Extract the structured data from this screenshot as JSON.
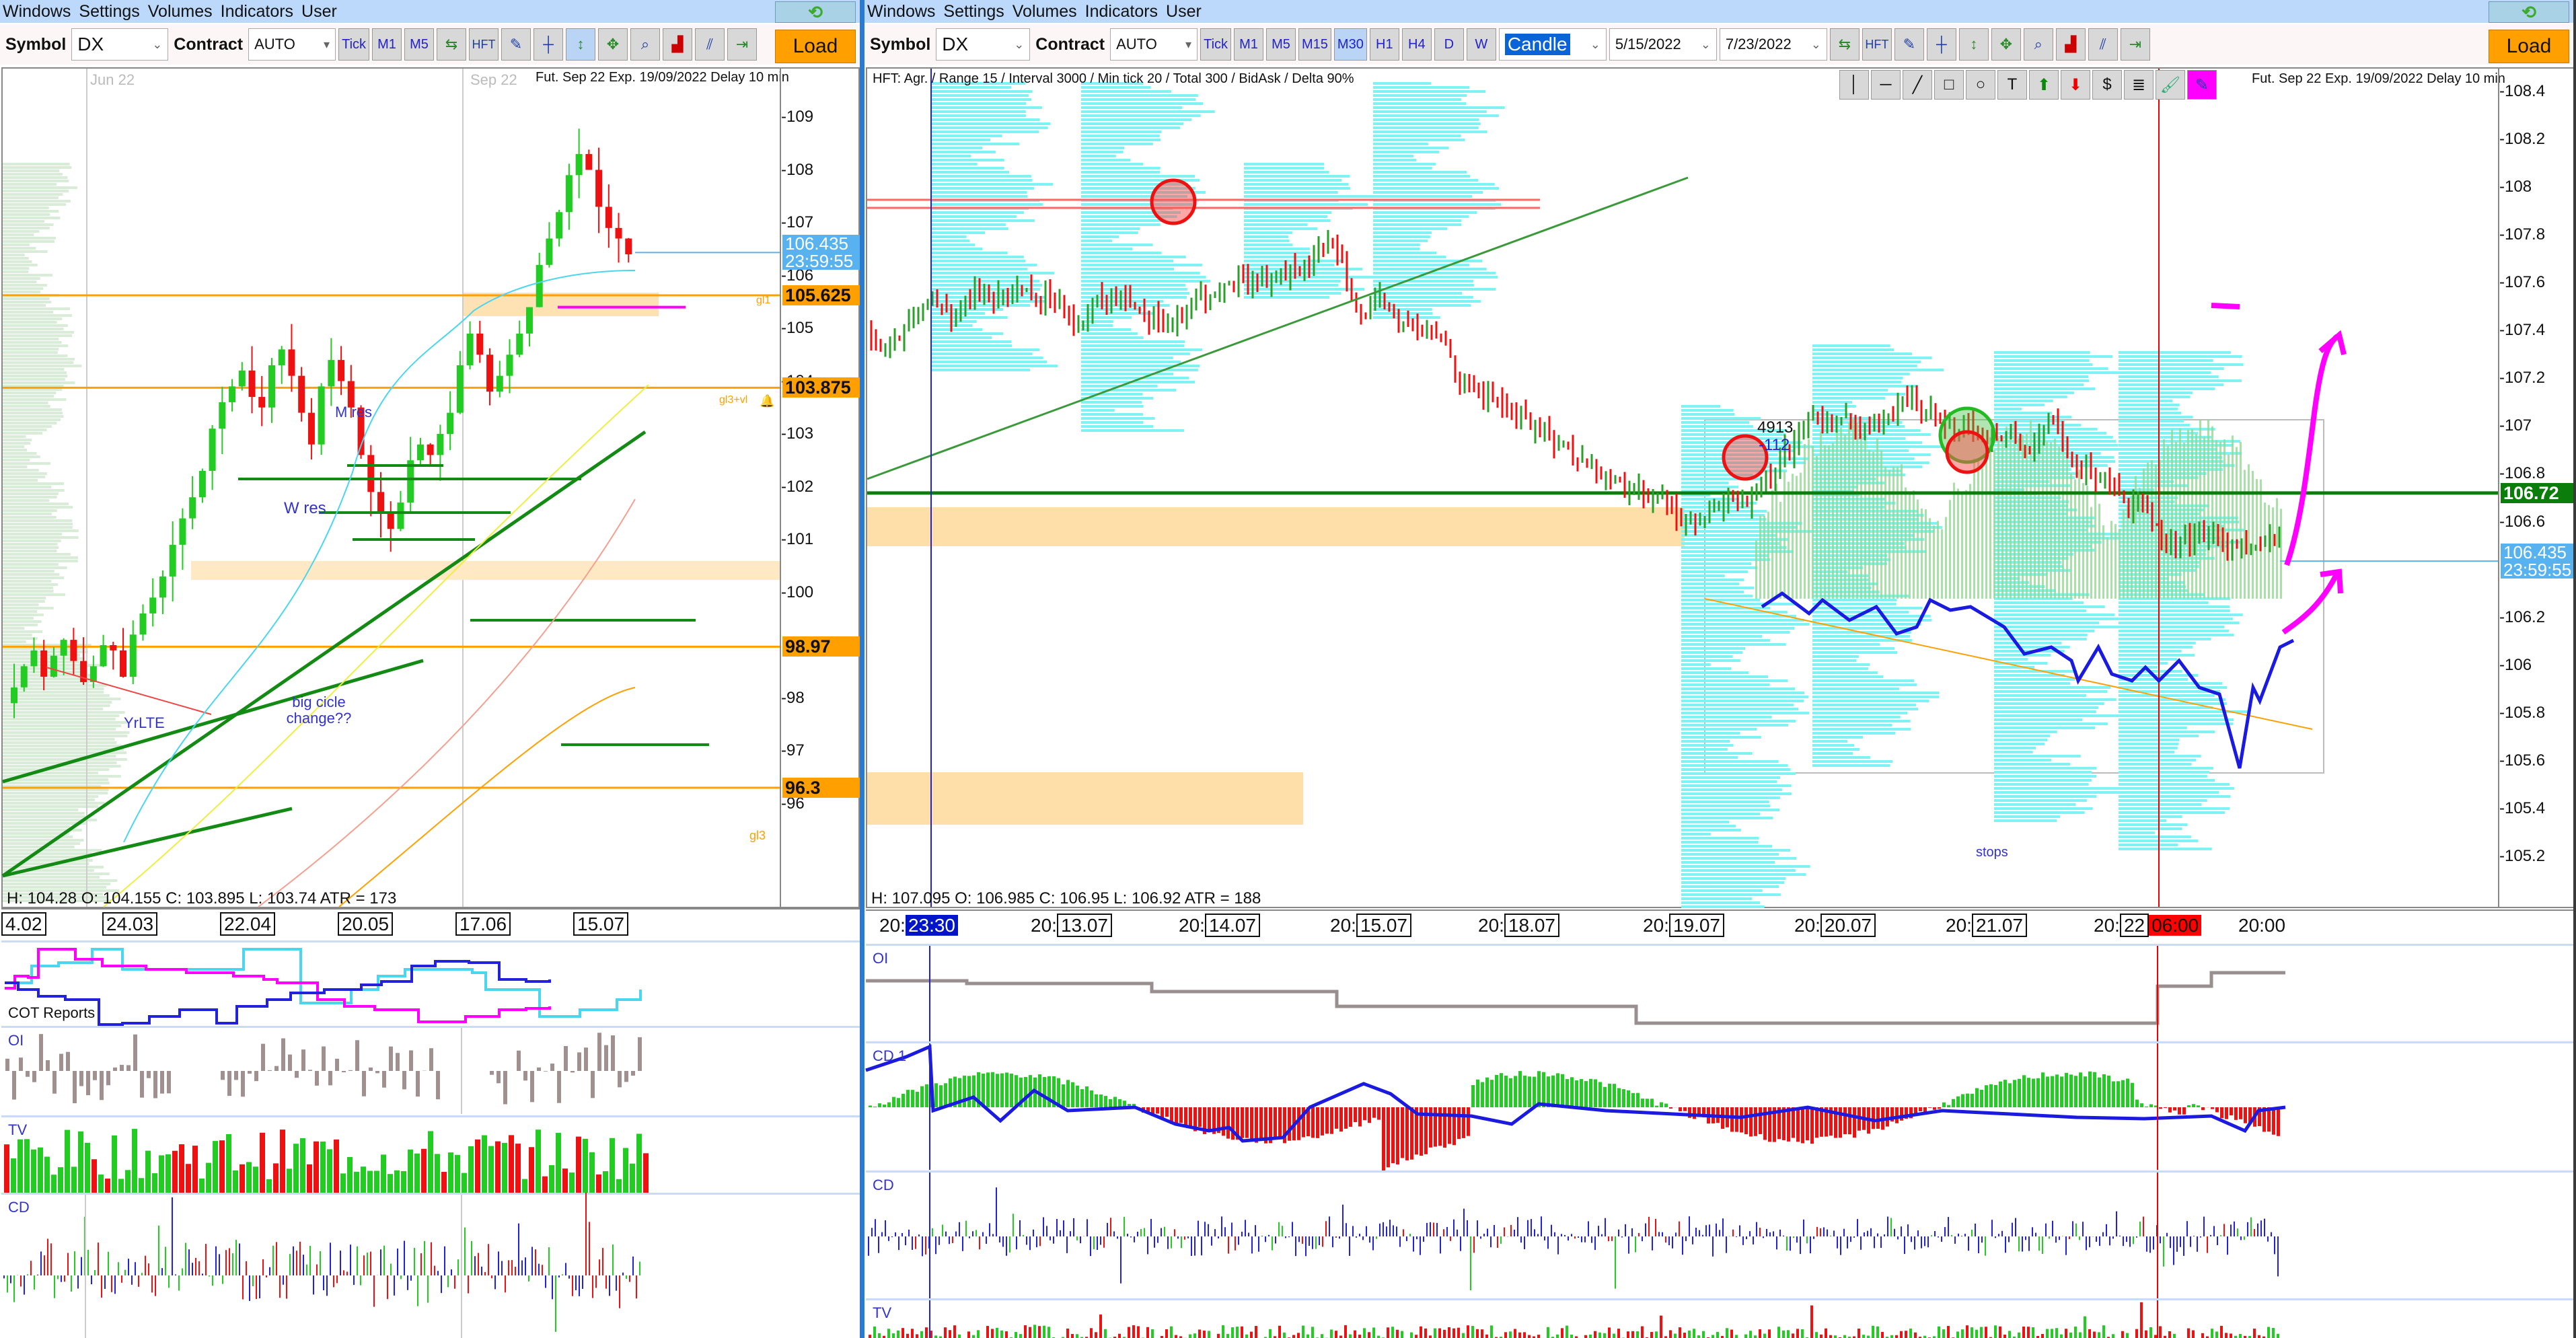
{
  "menu": [
    "Windows",
    "Settings",
    "Volumes",
    "Indicators",
    "User"
  ],
  "left": {
    "toolbar": {
      "symbol_label": "Symbol",
      "symbol_value": "DX",
      "contract_label": "Contract",
      "contract_value": "AUTO",
      "timeframes": [
        "Tick",
        "M1",
        "M5"
      ],
      "tools": [
        "sync-icon",
        "hft-icon",
        "pencil-icon",
        "crosshair-icon",
        "fit-vertical-icon",
        "fit-all-icon",
        "zoom-icon",
        "volume-profile-icon",
        "delta-icon",
        "measure-icon"
      ],
      "hft_label": "HFT",
      "load_label": "Load"
    },
    "chart": {
      "contract_info": "Fut. Sep 22 Exp. 19/09/2022 Delay 10 min",
      "period_labels": [
        "Jun 22",
        "Sep 22"
      ],
      "ohlc": "H: 104.28  O: 104.155  C: 103.895  L: 103.74  ATR = 173",
      "price_ticks": [
        "109",
        "108",
        "107",
        "106",
        "105",
        "104",
        "103",
        "102",
        "101",
        "100",
        "98",
        "97",
        "96"
      ],
      "tags": [
        {
          "value": "106.435",
          "time": "23:59:55",
          "kind": "last"
        },
        {
          "value": "105.625",
          "kind": "level"
        },
        {
          "value": "103.875",
          "kind": "level"
        },
        {
          "value": "98.97",
          "kind": "level"
        },
        {
          "value": "96.3",
          "kind": "level"
        }
      ],
      "level_labels": [
        "gl1",
        "gl3+vl",
        "gl3"
      ],
      "annotations": [
        "M res",
        "W res",
        "big cicle change??",
        "YrLTE"
      ],
      "date_labels": [
        "4.02",
        "24.03",
        "22.04",
        "20.05",
        "17.06",
        "15.07"
      ]
    },
    "panels": [
      "COT Reports",
      "OI",
      "TV",
      "CD"
    ]
  },
  "right": {
    "toolbar": {
      "symbol_label": "Symbol",
      "symbol_value": "DX",
      "contract_label": "Contract",
      "contract_value": "AUTO",
      "timeframes": [
        "Tick",
        "M1",
        "M5",
        "M15",
        "M30",
        "H1",
        "H4",
        "D",
        "W"
      ],
      "active_timeframe": "M30",
      "chart_type": "Candle",
      "date_from": "5/15/2022",
      "date_to": "7/23/2022",
      "hft_label": "HFT",
      "load_label": "Load"
    },
    "drawing_tools": [
      "vertical-line-icon",
      "horizontal-line-icon",
      "trend-line-icon",
      "rectangle-icon",
      "ellipse-icon",
      "text-icon",
      "arrow-up-icon",
      "arrow-down-icon",
      "dollar-icon",
      "fib-icon",
      "brush-icon",
      "pencil-icon"
    ],
    "chart": {
      "hft_info": "HFT: Agr. / Range 15 / Interval 3000 / Min tick 20 / Total 300 / BidAsk / Delta 90%",
      "contract_info": "Fut. Sep 22 Exp. 19/09/2022 Delay 10 min",
      "ohlc": "H: 107.095  O: 106.985  C: 106.95  L: 106.92  ATR = 188",
      "price_ticks": [
        "108.4",
        "108.2",
        "108",
        "107.8",
        "107.6",
        "107.4",
        "107.2",
        "107",
        "106.8",
        "106.6",
        "106.2",
        "106",
        "105.8",
        "105.6",
        "105.4",
        "105.2"
      ],
      "tags": [
        {
          "value": "106.72",
          "kind": "level"
        },
        {
          "value": "106.435",
          "time": "23:59:55",
          "kind": "last"
        }
      ],
      "annotations": {
        "volume": "4913",
        "delta": "-112",
        "stops": "stops"
      },
      "date_labels": [
        {
          "prefix": "20:",
          "date": "23:30",
          "highlight": "blue"
        },
        {
          "prefix": "20:",
          "date": "13.07"
        },
        {
          "prefix": "20:",
          "date": "14.07"
        },
        {
          "prefix": "20:",
          "date": "15.07"
        },
        {
          "prefix": "20:",
          "date": "18.07"
        },
        {
          "prefix": "20:",
          "date": "19.07"
        },
        {
          "prefix": "20:",
          "date": "20.07"
        },
        {
          "prefix": "20:",
          "date": "21.07"
        },
        {
          "prefix": "20:",
          "date": "22",
          "highlight_time": "06:00"
        },
        {
          "prefix": "",
          "date": "20:00"
        }
      ]
    },
    "panels": [
      "OI",
      "CD 1",
      "CD",
      "TV"
    ]
  },
  "colors": {
    "bull": "#22cc22",
    "bear": "#ee1111",
    "level": "#ffa000",
    "last_price": "#57b2ef",
    "key_level": "#0a7d0a",
    "profile": "#7ff3f3",
    "drawing": "#ff00ff"
  }
}
